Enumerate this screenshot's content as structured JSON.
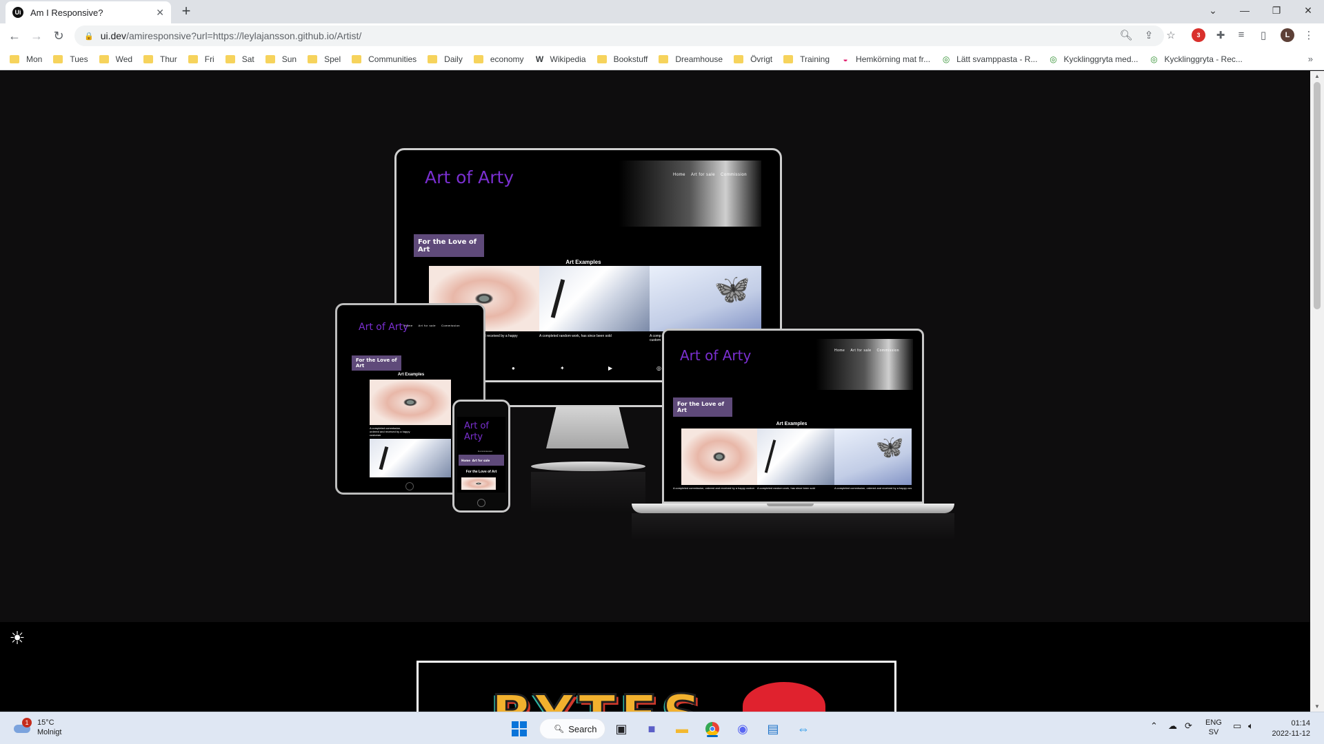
{
  "browser": {
    "tab_title": "Am I Responsive?",
    "tab_favicon": "Ui",
    "url_host": "ui.dev",
    "url_path": "/amiresponsive?url=https://leylajansson.github.io/Artist/",
    "profile_initial": "L",
    "extension_badge": "3",
    "bookmarks": [
      {
        "label": "Mon",
        "icon": "folder-icon"
      },
      {
        "label": "Tues",
        "icon": "folder-icon"
      },
      {
        "label": "Wed",
        "icon": "folder-icon"
      },
      {
        "label": "Thur",
        "icon": "folder-icon"
      },
      {
        "label": "Fri",
        "icon": "folder-icon"
      },
      {
        "label": "Sat",
        "icon": "folder-icon"
      },
      {
        "label": "Sun",
        "icon": "folder-icon"
      },
      {
        "label": "Spel",
        "icon": "folder-icon"
      },
      {
        "label": "Communities",
        "icon": "folder-icon"
      },
      {
        "label": "Daily",
        "icon": "folder-icon"
      },
      {
        "label": "economy",
        "icon": "folder-icon"
      },
      {
        "label": "Wikipedia",
        "icon": "wikipedia-icon"
      },
      {
        "label": "Bookstuff",
        "icon": "folder-icon"
      },
      {
        "label": "Dreamhouse",
        "icon": "folder-icon"
      },
      {
        "label": "Övrigt",
        "icon": "folder-icon"
      },
      {
        "label": "Training",
        "icon": "folder-icon"
      },
      {
        "label": "Hemkörning mat fr...",
        "icon": "food-site-icon"
      },
      {
        "label": "Lätt svamppasta - R...",
        "icon": "recipe-site-icon"
      },
      {
        "label": "Kycklinggryta med...",
        "icon": "recipe-site-icon"
      },
      {
        "label": "Kycklinggryta - Rec...",
        "icon": "recipe-site-icon"
      }
    ]
  },
  "site": {
    "brand": "Art of Arty",
    "brand_line1": "Art of",
    "brand_line2": "Arty",
    "nav": [
      "Home",
      "Art for sale",
      "Commission"
    ],
    "tagline": "For the Love of Art",
    "examples_title": "Art Examples",
    "captions": [
      "A completed commission, ordered and received by a happy customer",
      "A completed random work, has since been sold",
      "A completed commission, ordered and received by a happy customer"
    ],
    "monitor_caption_1": "d and received by a happy",
    "monitor_caption_2": "A completed random work, has since been sold",
    "monitor_caption_3": "A comp",
    "monitor_caption_3b": "custom",
    "tablet_caption": "A completed commission, ordered and received by a happy customer",
    "social_icons": [
      "facebook-icon",
      "twitter-icon",
      "youtube-icon",
      "instagram-icon"
    ]
  },
  "bottom_card": {
    "logo_text": "BYTES"
  },
  "taskbar": {
    "weather_temp": "15°C",
    "weather_desc": "Molnigt",
    "weather_badge": "1",
    "search_label": "Search",
    "lang_top": "ENG",
    "lang_bottom": "SV",
    "time": "01:14",
    "date": "2022-11-12"
  },
  "colors": {
    "brand_purple": "#7a2fd0",
    "tagline_bg": "#5f4a7a",
    "page_bg": "#0e0d0e"
  }
}
